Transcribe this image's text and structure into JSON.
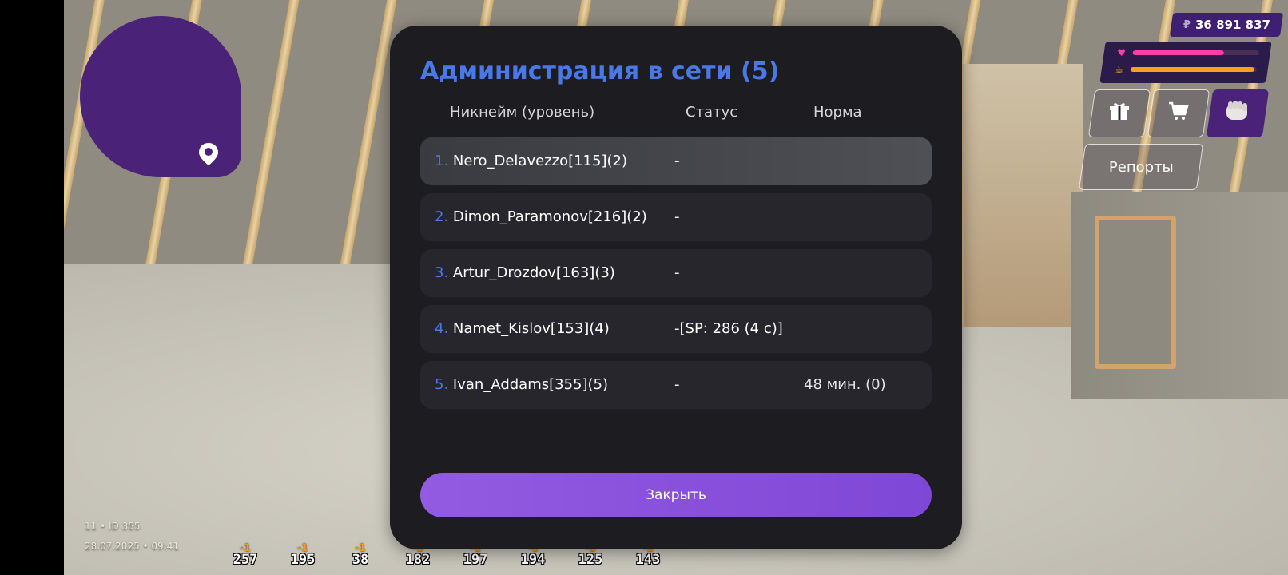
{
  "dialog": {
    "title": "Администрация в сети (5)",
    "columns": {
      "nickname": "Никнейм (уровень)",
      "status": "Статус",
      "norm": "Норма"
    },
    "rows": [
      {
        "num": "1.",
        "name": "Nero_Delavezzo[115](2)",
        "status": "-",
        "norm": ""
      },
      {
        "num": "2.",
        "name": "Dimon_Paramonov[216](2)",
        "status": "-",
        "norm": ""
      },
      {
        "num": "3.",
        "name": "Artur_Drozdov[163](3)",
        "status": "-",
        "norm": ""
      },
      {
        "num": "4.",
        "name": "Namet_Kislov[153](4)",
        "status": "-[SP: 286 (4 с)]",
        "norm": ""
      },
      {
        "num": "5.",
        "name": "Ivan_Addams[355](5)",
        "status": "-",
        "norm": "48 мин. (0)"
      }
    ],
    "close_label": "Закрыть"
  },
  "hud": {
    "money_symbol": "₽",
    "money": "36 891 837",
    "health_fill": 0.72,
    "hunger_fill": 0.98,
    "health_color": "#ff3fa5",
    "hunger_color": "#f7a21b",
    "buttons": [
      "gift-icon",
      "cart-icon",
      "fist-icon"
    ],
    "reports_label": "Репорты"
  },
  "info": {
    "server_id": "11 • ID 355",
    "datetime": "28.07.2025 • 09:41"
  },
  "ammo": [
    {
      "minus": "-1",
      "value": "257"
    },
    {
      "minus": "-1",
      "value": "195"
    },
    {
      "minus": "-1",
      "value": "38"
    },
    {
      "minus": "-1",
      "value": "182"
    },
    {
      "minus": "-1",
      "value": "197"
    },
    {
      "minus": "-1",
      "value": "194"
    },
    {
      "minus": "-1",
      "value": "125"
    },
    {
      "minus": "-1",
      "value": "143"
    }
  ],
  "colors": {
    "accent": "#4a78e8",
    "minimap": "#4a2278",
    "dialog_bg": "#1c1c21",
    "close_button": "#8a52dc"
  }
}
